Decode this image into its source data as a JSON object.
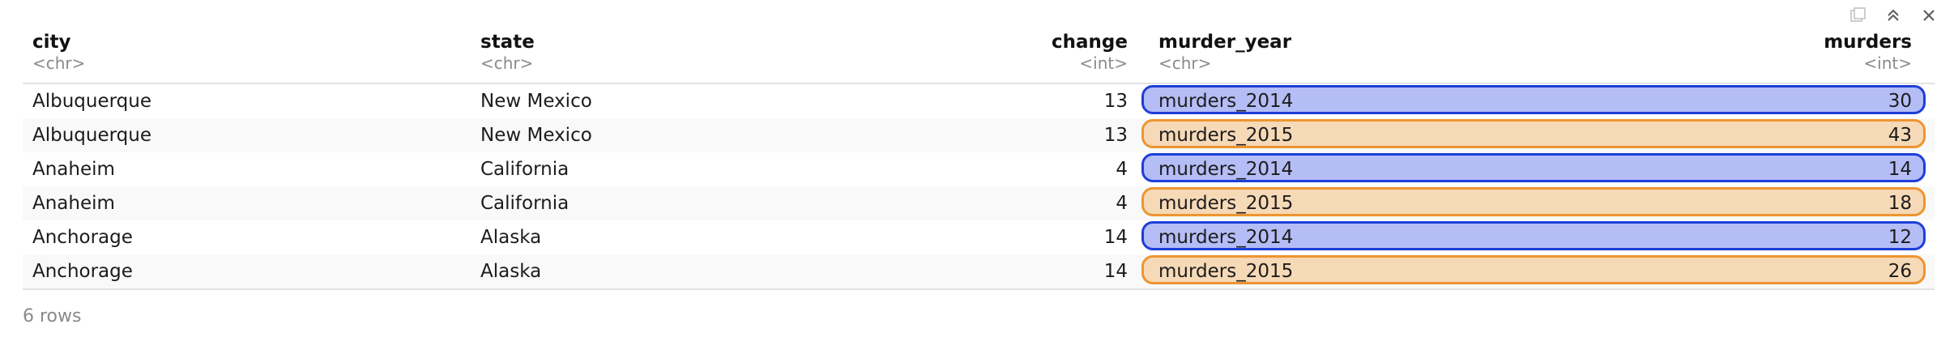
{
  "toolbar": {
    "icons": [
      "copy-icon",
      "collapse-icon",
      "close-icon"
    ]
  },
  "columns": [
    {
      "name": "city",
      "type": "<chr>"
    },
    {
      "name": "state",
      "type": "<chr>"
    },
    {
      "name": "change",
      "type": "<int>"
    },
    {
      "name": "murder_year",
      "type": "<chr>"
    },
    {
      "name": "murders",
      "type": "<int>"
    }
  ],
  "rows": [
    {
      "city": "Albuquerque",
      "state": "New Mexico",
      "change": "13",
      "murder_year": "murders_2014",
      "murders": "30"
    },
    {
      "city": "Albuquerque",
      "state": "New Mexico",
      "change": "13",
      "murder_year": "murders_2015",
      "murders": "43"
    },
    {
      "city": "Anaheim",
      "state": "California",
      "change": "4",
      "murder_year": "murders_2014",
      "murders": "14"
    },
    {
      "city": "Anaheim",
      "state": "California",
      "change": "4",
      "murder_year": "murders_2015",
      "murders": "18"
    },
    {
      "city": "Anchorage",
      "state": "Alaska",
      "change": "14",
      "murder_year": "murders_2014",
      "murders": "12"
    },
    {
      "city": "Anchorage",
      "state": "Alaska",
      "change": "14",
      "murder_year": "murders_2015",
      "murders": "26"
    }
  ],
  "highlight_colors": {
    "murders_2014": {
      "fill": "#b4bdf6",
      "border": "#1e3ed8"
    },
    "murders_2015": {
      "fill": "#f6d9b6",
      "border": "#ed9532"
    }
  },
  "footer": {
    "row_count": "6 rows"
  }
}
